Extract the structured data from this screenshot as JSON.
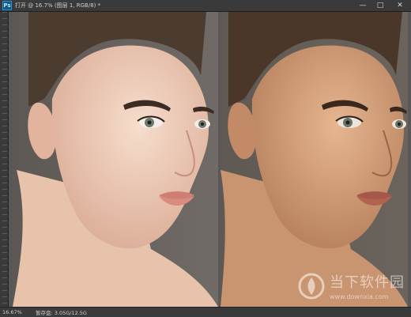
{
  "window": {
    "title": "打开 @ 16.7% (图层 1, RGB/8) *",
    "controls": [
      "—",
      "□",
      "✕"
    ]
  },
  "status": {
    "zoom": "16.67%",
    "doc_info": "暂存盘: 3.05G/12.5G"
  },
  "watermark": {
    "name": "当下软件园",
    "url": "www.downxia.com"
  },
  "colors": {
    "canvas_bg": "#585858",
    "skin_before": "#f0d3c0",
    "skin_after": "#d6a27b"
  }
}
